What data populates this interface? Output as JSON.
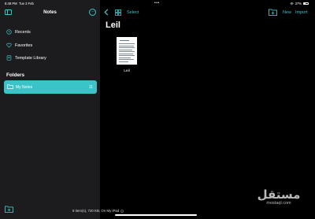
{
  "status_bar": {
    "time": "8:48 PM",
    "date": "Tue 3 Feb",
    "dots": "•••",
    "battery": "37%"
  },
  "sidebar": {
    "title": "Notes",
    "items": [
      {
        "label": "Recents",
        "icon": "clock-icon"
      },
      {
        "label": "Favorites",
        "icon": "heart-icon"
      },
      {
        "label": "Template Library",
        "icon": "template-icon"
      }
    ],
    "folders_heading": "Folders",
    "folders": [
      {
        "label": "My Notes",
        "count": "11",
        "selected": true
      }
    ]
  },
  "toolbar": {
    "select": "Select",
    "new": "New",
    "import": "Import"
  },
  "main": {
    "folder_title": "Leil",
    "documents": [
      {
        "name": "Leil"
      }
    ],
    "footer": "8 item(s), 720 KB, On My iPad"
  },
  "watermark": {
    "arabic": "مستقل",
    "latin": "mostaql.com"
  },
  "colors": {
    "accent": "#3bc4c8",
    "sidebar_bg": "#1c1c1e",
    "main_bg": "#000000"
  }
}
